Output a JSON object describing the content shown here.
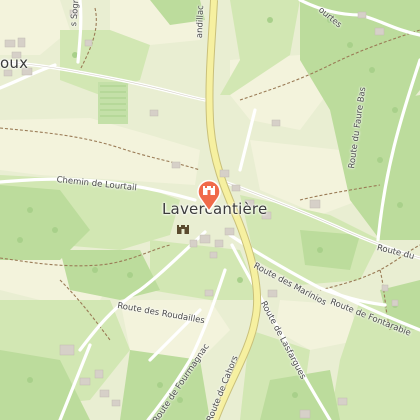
{
  "map": {
    "locality_label": "Lavercantière",
    "partial_label_top_left": "oux",
    "road_labels": {
      "chemin_de_lourtail": "Chemin de Lourtail",
      "route_des_roudailles": "Route des Roudailles",
      "route_des_marinios": "Route des Marinios",
      "route_de_lasfargues": "Route de Lasfargues",
      "route_de_fontarabie": "Route de Fontarabie",
      "route_du_faure_bas": "Route du Faure Bas",
      "route_du": "Route du",
      "route_de_cahors": "Route de Cahors",
      "route_de_fourmagnac": "Route de Fourmagnac",
      "sogne_partial": "s Sogne",
      "top_center_partial": "andillac",
      "top_right_partial": "ourtes"
    },
    "marker": {
      "type": "pin",
      "icon": "castle-icon",
      "color": "#f06a4a"
    },
    "poi": {
      "type": "castle",
      "icon": "castle-icon"
    },
    "colors": {
      "grass": "#cfe5b0",
      "forest": "#b9dc9a",
      "farmland": "#f4f3dc",
      "main_road": "#f6f0a0",
      "road": "#ffffff",
      "trail": "#9a7b56",
      "building": "#d6d0c8"
    }
  }
}
